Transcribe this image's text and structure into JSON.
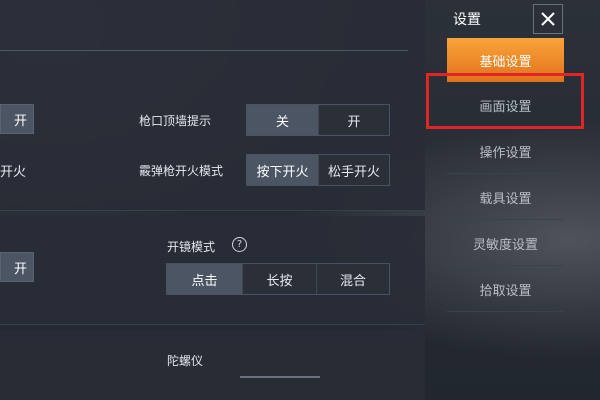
{
  "settings": {
    "title": "设置",
    "close_icon": "close-icon",
    "menu": [
      {
        "label": "基础设置",
        "active": true
      },
      {
        "label": "画面设置",
        "active": false
      },
      {
        "label": "操作设置",
        "active": false
      },
      {
        "label": "载具设置",
        "active": false
      },
      {
        "label": "灵敏度设置",
        "active": false
      },
      {
        "label": "拾取设置",
        "active": false
      }
    ],
    "accent_color": "#f08a2a",
    "highlight_color": "#e02525"
  },
  "options": {
    "partial_1": "开",
    "partial_2": "开火",
    "partial_3": "开",
    "muzzle_wall": {
      "label": "枪口顶墙提示",
      "choices": [
        "关",
        "开"
      ],
      "selected": "关"
    },
    "shotgun_fire": {
      "label": "霰弹枪开火模式",
      "choices": [
        "按下开火",
        "松手开火"
      ],
      "selected": "按下开火"
    },
    "scope_mode": {
      "label": "开镜模式",
      "help_icon": "help-icon",
      "choices": [
        "点击",
        "长按",
        "混合"
      ],
      "selected": "点击"
    },
    "gyroscope": {
      "label": "陀螺仪"
    }
  }
}
